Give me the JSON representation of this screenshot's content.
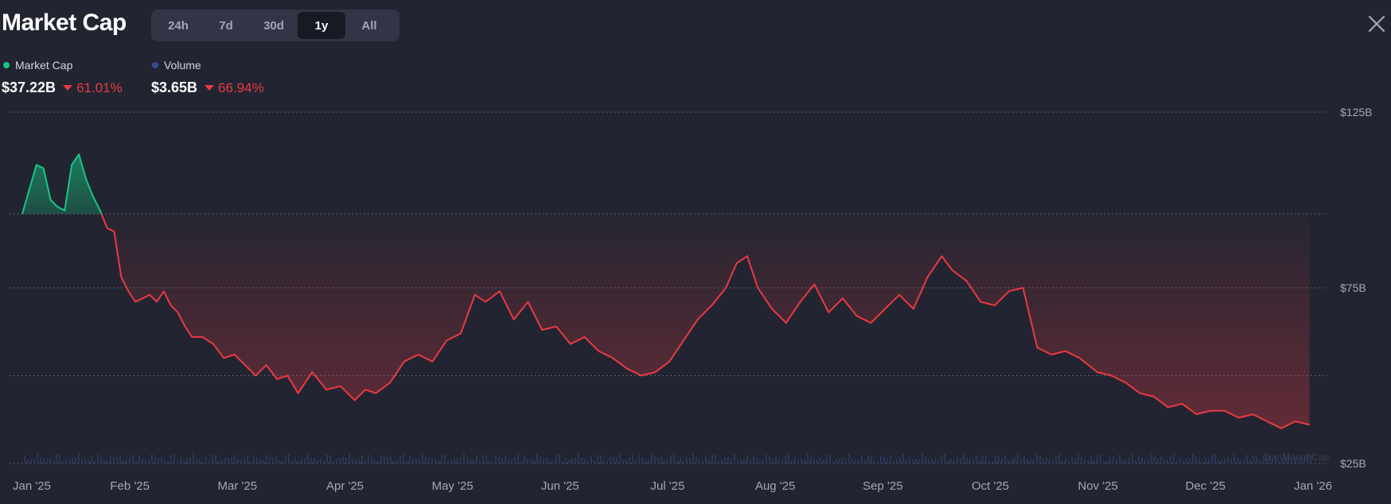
{
  "title": "Market Cap",
  "ranges": [
    "24h",
    "7d",
    "30d",
    "1y",
    "All"
  ],
  "active_range": "1y",
  "legend": {
    "market_cap": {
      "label": "Market Cap",
      "value": "$37.22B",
      "change": "61.01%",
      "color": "#16c784"
    },
    "volume": {
      "label": "Volume",
      "value": "$3.65B",
      "change": "66.94%",
      "color": "#3a4a8a"
    }
  },
  "colors": {
    "up": "#16c784",
    "down": "#ea3943",
    "background": "#222531"
  },
  "watermark": "CoinMarketCap",
  "chart_data": {
    "type": "line",
    "x_axis": {
      "tick_labels": [
        "Jan '25",
        "Feb '25",
        "Mar '25",
        "Apr '25",
        "May '25",
        "Jun '25",
        "Jul '25",
        "Aug '25",
        "Sep '25",
        "Oct '25",
        "Nov '25",
        "Dec '25",
        "Jan '26"
      ]
    },
    "y_axis": {
      "tick_labels": [
        "$125B",
        "$75B",
        "$25B"
      ],
      "ylim": [
        25,
        125
      ],
      "unit": "B"
    },
    "baseline": 96,
    "grid": true,
    "series": [
      {
        "name": "Market Cap",
        "x": [
          "2025-01-01",
          "2025-01-03",
          "2025-01-05",
          "2025-01-07",
          "2025-01-09",
          "2025-01-11",
          "2025-01-13",
          "2025-01-15",
          "2025-01-17",
          "2025-01-19",
          "2025-01-21",
          "2025-01-23",
          "2025-01-25",
          "2025-01-27",
          "2025-01-29",
          "2025-01-31",
          "2025-02-02",
          "2025-02-04",
          "2025-02-06",
          "2025-02-08",
          "2025-02-10",
          "2025-02-12",
          "2025-02-14",
          "2025-02-16",
          "2025-02-18",
          "2025-02-21",
          "2025-02-24",
          "2025-02-27",
          "2025-03-02",
          "2025-03-05",
          "2025-03-08",
          "2025-03-11",
          "2025-03-14",
          "2025-03-17",
          "2025-03-20",
          "2025-03-24",
          "2025-03-28",
          "2025-04-01",
          "2025-04-05",
          "2025-04-08",
          "2025-04-11",
          "2025-04-15",
          "2025-04-19",
          "2025-04-23",
          "2025-04-27",
          "2025-05-01",
          "2025-05-05",
          "2025-05-09",
          "2025-05-12",
          "2025-05-16",
          "2025-05-20",
          "2025-05-24",
          "2025-05-28",
          "2025-06-01",
          "2025-06-05",
          "2025-06-09",
          "2025-06-13",
          "2025-06-17",
          "2025-06-21",
          "2025-06-25",
          "2025-06-29",
          "2025-07-03",
          "2025-07-07",
          "2025-07-11",
          "2025-07-15",
          "2025-07-19",
          "2025-07-22",
          "2025-07-25",
          "2025-07-28",
          "2025-08-01",
          "2025-08-05",
          "2025-08-09",
          "2025-08-13",
          "2025-08-17",
          "2025-08-21",
          "2025-08-25",
          "2025-08-29",
          "2025-09-02",
          "2025-09-06",
          "2025-09-10",
          "2025-09-14",
          "2025-09-18",
          "2025-09-21",
          "2025-09-25",
          "2025-09-29",
          "2025-10-03",
          "2025-10-07",
          "2025-10-11",
          "2025-10-15",
          "2025-10-19",
          "2025-10-23",
          "2025-10-27",
          "2025-11-01",
          "2025-11-05",
          "2025-11-09",
          "2025-11-13",
          "2025-11-17",
          "2025-11-21",
          "2025-11-25",
          "2025-11-29",
          "2025-12-03",
          "2025-12-07",
          "2025-12-11",
          "2025-12-15",
          "2025-12-19",
          "2025-12-23",
          "2025-12-27",
          "2025-12-31"
        ],
        "values": [
          96,
          103,
          110,
          109,
          100,
          98,
          97,
          110,
          113,
          106,
          101,
          97,
          92,
          91,
          78,
          74,
          71,
          72,
          73,
          71,
          74,
          70,
          68,
          64,
          61,
          61,
          59,
          55,
          56,
          53,
          50,
          53,
          49,
          50,
          45,
          51,
          46,
          47,
          43,
          46,
          45,
          48,
          54,
          56,
          54,
          60,
          62,
          73,
          71,
          74,
          66,
          71,
          63,
          64,
          59,
          61,
          57,
          55,
          52,
          50,
          51,
          54,
          60,
          66,
          70,
          75,
          82,
          84,
          75,
          69,
          65,
          71,
          76,
          68,
          72,
          67,
          65,
          69,
          73,
          69,
          78,
          84,
          80,
          77,
          71,
          70,
          74,
          75,
          58,
          56,
          57,
          55,
          51,
          50,
          48,
          45,
          44,
          41,
          42,
          39,
          40,
          40,
          38,
          39,
          37,
          35,
          37,
          36
        ]
      }
    ]
  }
}
